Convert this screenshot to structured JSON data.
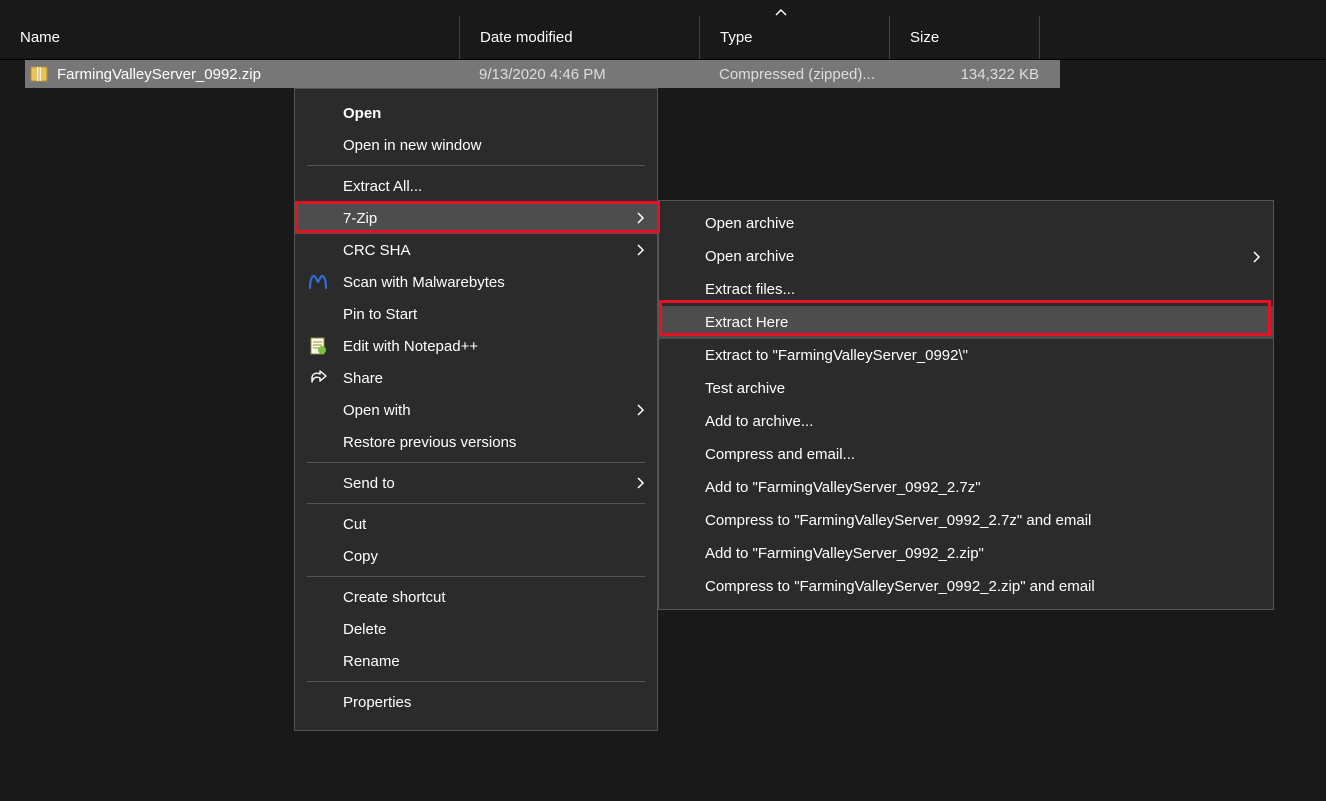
{
  "columns": {
    "name": "Name",
    "date": "Date modified",
    "type": "Type",
    "size": "Size"
  },
  "file": {
    "name": "FarmingValleyServer_0992.zip",
    "date": "9/13/2020 4:46 PM",
    "type": "Compressed (zipped)...",
    "size": "134,322 KB"
  },
  "menu": {
    "open": "Open",
    "open_new_window": "Open in new window",
    "extract_all": "Extract All...",
    "seven_zip": "7-Zip",
    "crc_sha": "CRC SHA",
    "malwarebytes": "Scan with Malwarebytes",
    "pin_start": "Pin to Start",
    "notepadpp": "Edit with Notepad++",
    "share": "Share",
    "open_with": "Open with",
    "restore_prev": "Restore previous versions",
    "send_to": "Send to",
    "cut": "Cut",
    "copy": "Copy",
    "create_shortcut": "Create shortcut",
    "delete": "Delete",
    "rename": "Rename",
    "properties": "Properties"
  },
  "submenu": {
    "open_archive1": "Open archive",
    "open_archive2": "Open archive",
    "extract_files": "Extract files...",
    "extract_here": "Extract Here",
    "extract_to": "Extract to \"FarmingValleyServer_0992\\\"",
    "test_archive": "Test archive",
    "add_archive": "Add to archive...",
    "compress_email": "Compress and email...",
    "add_7z": "Add to \"FarmingValleyServer_0992_2.7z\"",
    "compress_7z_email": "Compress to \"FarmingValleyServer_0992_2.7z\" and email",
    "add_zip": "Add to \"FarmingValleyServer_0992_2.zip\"",
    "compress_zip_email": "Compress to \"FarmingValleyServer_0992_2.zip\" and email"
  },
  "sort_indicator": "︿"
}
